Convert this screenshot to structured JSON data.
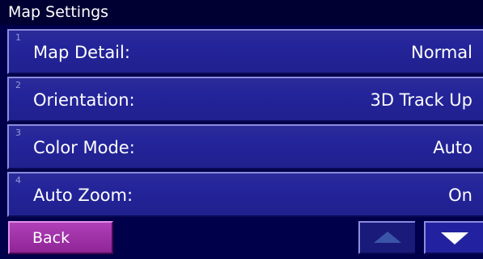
{
  "header": {
    "title": "Map Settings"
  },
  "settings": [
    {
      "number": "1",
      "label": "Map Detail:",
      "value": "Normal"
    },
    {
      "number": "2",
      "label": "Orientation:",
      "value": "3D Track Up"
    },
    {
      "number": "3",
      "label": "Color Mode:",
      "value": "Auto"
    },
    {
      "number": "4",
      "label": "Auto Zoom:",
      "value": "On"
    }
  ],
  "footer": {
    "back_label": "Back",
    "scroll_up_icon": "up-arrow-icon",
    "scroll_down_icon": "down-arrow-icon"
  },
  "colors": {
    "background": "#00004a",
    "row": "#24249a",
    "back_button": "#a030a8",
    "arrow_up": "#3a55a8",
    "arrow_down": "#ffffff"
  }
}
